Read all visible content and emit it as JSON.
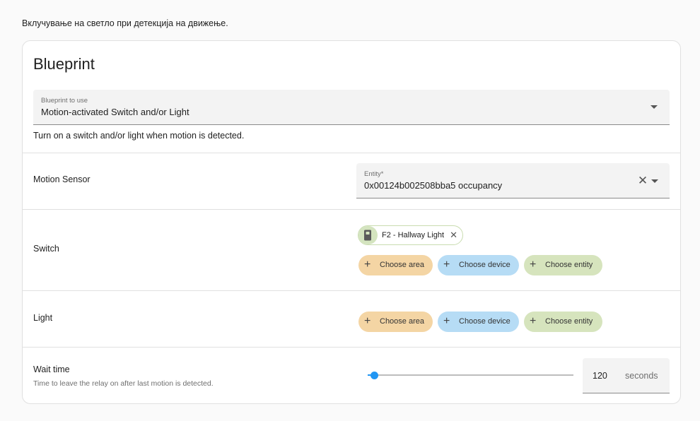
{
  "automation": {
    "description": "Вклучување на светло при детекција на движење."
  },
  "blueprint": {
    "title": "Blueprint",
    "select_label": "Blueprint to use",
    "select_value": "Motion-activated Switch and/or Light",
    "description": "Turn on a switch and/or light when motion is detected."
  },
  "inputs": {
    "motion_sensor": {
      "label": "Motion Sensor",
      "field_label": "Entity*",
      "value": "0x00124b002508bba5 occupancy"
    },
    "switch": {
      "label": "Switch",
      "selected_chip": "F2 - Hallway Light",
      "choose_area": "Choose area",
      "choose_device": "Choose device",
      "choose_entity": "Choose entity"
    },
    "light": {
      "label": "Light",
      "choose_area": "Choose area",
      "choose_device": "Choose device",
      "choose_entity": "Choose entity"
    },
    "wait_time": {
      "label": "Wait time",
      "description": "Time to leave the relay on after last motion is detected.",
      "value": "120",
      "unit": "seconds",
      "slider_fraction": 0.03
    }
  },
  "icons": {
    "chip_icon": "light-switch-icon",
    "plus": "+",
    "close": "✕"
  },
  "colors": {
    "area_pill": "#f4d5a4",
    "device_pill": "#b6dcf5",
    "entity_pill": "#d6e4bd",
    "slider": "#2196f3"
  }
}
